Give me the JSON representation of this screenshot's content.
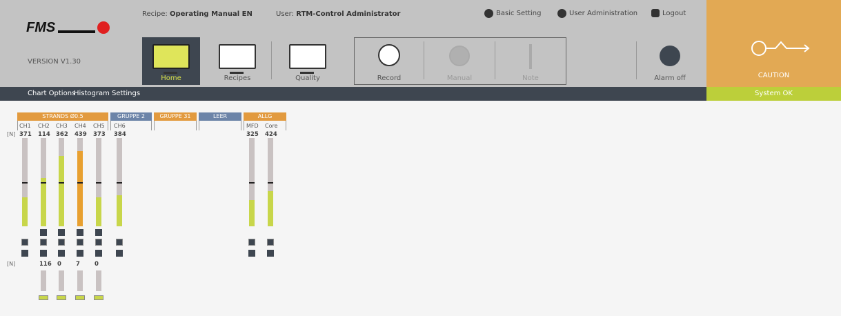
{
  "header": {
    "logo_text": "FMS",
    "version": "VERSION V1.30",
    "recipe_label": "Recipe:",
    "recipe_value": "Operating Manual EN",
    "user_label": "User:",
    "user_value": "RTM-Control Administrator",
    "basic_setting": "Basic Setting",
    "user_admin": "User Administration",
    "logout": "Logout"
  },
  "nav": {
    "home": "Home",
    "recipes": "Recipes",
    "quality": "Quality",
    "record": "Record",
    "manual": "Manual",
    "note": "Note",
    "alarm_off": "Alarm off"
  },
  "caution": "CAUTION",
  "menubar": {
    "chart_options": "Chart Options",
    "histogram_settings": "Histogram Settings"
  },
  "status": "System OK",
  "groups": [
    {
      "label": "STRANDS Ø0.5",
      "color": "#e29a3f"
    },
    {
      "label": "GRUPPE 2",
      "color": "#6c84a8"
    },
    {
      "label": "GRUPPE 31",
      "color": "#e29a3f"
    },
    {
      "label": "LEER",
      "color": "#6c84a8"
    },
    {
      "label": "ALLG",
      "color": "#e29a3f"
    }
  ],
  "unit": "[N]",
  "channels": [
    {
      "name": "CH1",
      "value": "371",
      "fill": 0.33,
      "color": "#c8d64a"
    },
    {
      "name": "CH2",
      "value": "114",
      "fill": 0.55,
      "color": "#c8d64a"
    },
    {
      "name": "CH3",
      "value": "362",
      "fill": 0.8,
      "color": "#c8d64a"
    },
    {
      "name": "CH4",
      "value": "439",
      "fill": 0.85,
      "color": "#e8a030"
    },
    {
      "name": "CH5",
      "value": "373",
      "fill": 0.33,
      "color": "#c8d64a"
    },
    {
      "name": "CH6",
      "value": "384",
      "fill": 0.35,
      "color": "#c8d64a"
    },
    {
      "name": "MFD",
      "value": "325",
      "fill": 0.3,
      "color": "#c8d64a"
    },
    {
      "name": "Core",
      "value": "424",
      "fill": 0.4,
      "color": "#c8d64a"
    }
  ],
  "lower_values": [
    "116",
    "0",
    "7",
    "0"
  ]
}
